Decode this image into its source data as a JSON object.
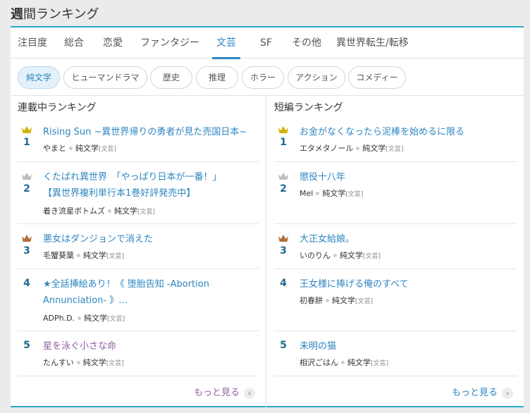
{
  "heading": {
    "prefix": "週",
    "rest": "間ランキング"
  },
  "tabs": [
    {
      "label": "注目度"
    },
    {
      "label": "総合"
    },
    {
      "label": "恋愛"
    },
    {
      "label": "ファンタジー"
    },
    {
      "label": "文芸"
    },
    {
      "label": "SF"
    },
    {
      "label": "その他"
    },
    {
      "label": "異世界転生/転移"
    }
  ],
  "active_tab": "文芸",
  "genres": [
    {
      "label": "純文学"
    },
    {
      "label": "ヒューマンドラマ"
    },
    {
      "label": "歴史"
    },
    {
      "label": "推理"
    },
    {
      "label": "ホラー"
    },
    {
      "label": "アクション"
    },
    {
      "label": "コメディー"
    }
  ],
  "active_genre": "純文学",
  "serial": {
    "heading": "連載中ランキング",
    "items": [
      {
        "rank": "1",
        "crown": "gold",
        "title": "Rising Sun ~異世界帰りの勇者が見た売国日本~",
        "author": "やまと",
        "genre": "純文学",
        "genre_parent": "文芸"
      },
      {
        "rank": "2",
        "crown": "silver",
        "title_line1": "くたばれ異世界　「やっぱり日本が一番！」",
        "title_line2": "【異世界複利単行本1巻好評発売中】",
        "author": "着き流星ボトムズ",
        "genre": "純文学",
        "genre_parent": "文芸"
      },
      {
        "rank": "3",
        "crown": "bronze",
        "title": "悪女はダンジョンで消えた",
        "author": "毛蟹葵葉",
        "genre": "純文学",
        "genre_parent": "文芸"
      },
      {
        "rank": "4",
        "title_line1": "★全話挿絵あり！《 堕胎告知 -Abortion",
        "title_line2": "Annunciation- 》...",
        "author": "ADPh.D.",
        "genre": "純文学",
        "genre_parent": "文芸"
      },
      {
        "rank": "5",
        "title": "星を泳ぐ小さな命",
        "author": "たんすい",
        "genre": "純文学",
        "genre_parent": "文芸"
      }
    ],
    "more": "もっと見る"
  },
  "short": {
    "heading": "短編ランキング",
    "items": [
      {
        "rank": "1",
        "crown": "gold",
        "title": "お金がなくなったら泥棒を始めるに限る",
        "author": "エタメタノール",
        "genre": "純文学",
        "genre_parent": "文芸"
      },
      {
        "rank": "2",
        "crown": "silver",
        "title": "懲役十八年",
        "author": "Mel",
        "genre": "純文学",
        "genre_parent": "文芸"
      },
      {
        "rank": "3",
        "crown": "bronze",
        "title": "大正女給娘。",
        "author": "いのりん",
        "genre": "純文学",
        "genre_parent": "文芸"
      },
      {
        "rank": "4",
        "title": "王女様に捧げる俺のすべて",
        "author": "初春餅",
        "genre": "純文学",
        "genre_parent": "文芸"
      },
      {
        "rank": "5",
        "title": "未明の猫",
        "author": "相沢ごはん",
        "genre": "純文学",
        "genre_parent": "文芸"
      }
    ],
    "more": "もっと見る"
  },
  "colors": {
    "accent": "#2e86c1",
    "visited": "#8f5fa3",
    "rank": "#1f6b91",
    "gold": "#d4b20c",
    "silver": "#bdbdbd",
    "bronze": "#b2703a"
  }
}
